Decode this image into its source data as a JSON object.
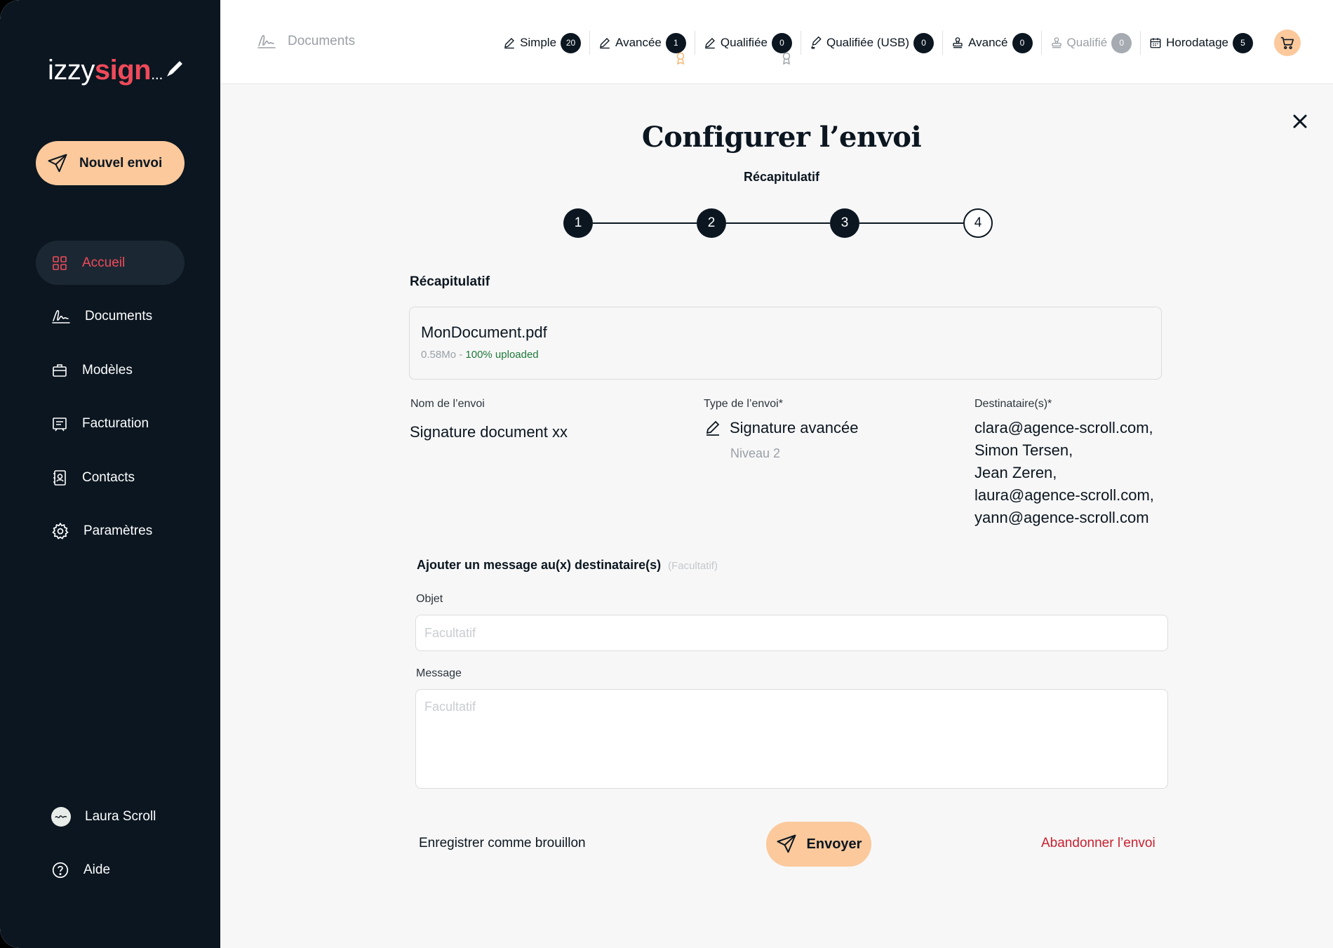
{
  "brand": {
    "part1": "izzy",
    "part2": "sign",
    "part3": "..."
  },
  "sidebar": {
    "new_button": "Nouvel envoi",
    "items": [
      {
        "label": "Accueil",
        "icon": "grid-icon",
        "active": true
      },
      {
        "label": "Documents",
        "icon": "signature-icon"
      },
      {
        "label": "Modèles",
        "icon": "briefcase-icon"
      },
      {
        "label": "Facturation",
        "icon": "invoice-icon"
      },
      {
        "label": "Contacts",
        "icon": "contact-icon"
      },
      {
        "label": "Paramètres",
        "icon": "gear-icon"
      }
    ],
    "user": "Laura Scroll",
    "help": "Aide"
  },
  "topbar": {
    "breadcrumb": "Documents",
    "counters": [
      {
        "label": "Simple",
        "count": "20"
      },
      {
        "label": "Avancée",
        "count": "1"
      },
      {
        "label": "Qualifiée",
        "count": "0"
      },
      {
        "label": "Qualifiée (USB)",
        "count": "0"
      },
      {
        "label": "Avancé",
        "count": "0"
      },
      {
        "label": "Qualifié",
        "count": "0"
      },
      {
        "label": "Horodatage",
        "count": "5"
      }
    ]
  },
  "page": {
    "title": "Configurer l’envoi",
    "subtitle": "Récapitulatif",
    "steps": [
      "1",
      "2",
      "3",
      "4"
    ],
    "current_step": 3,
    "section_title": "Récapitulatif"
  },
  "file": {
    "name": "MonDocument.pdf",
    "size": "0.58Mo",
    "separator": " - ",
    "status": "100% uploaded"
  },
  "summary": {
    "name_label": "Nom de l’envoi",
    "name_value": "Signature document xx",
    "type_label": "Type de l’envoi*",
    "type_value": "Signature avancée",
    "type_level": "Niveau 2",
    "recipients_label": "Destinataire(s)*",
    "recipients": [
      "clara@agence-scroll.com,",
      "Simon Tersen,",
      "Jean Zeren,",
      "laura@agence-scroll.com,",
      "yann@agence-scroll.com"
    ]
  },
  "message": {
    "title": "Ajouter un message au(x) destinataire(s)",
    "optional": "(Facultatif)",
    "subject_label": "Objet",
    "subject_placeholder": "Facultatif",
    "body_label": "Message",
    "body_placeholder": "Facultatif"
  },
  "actions": {
    "draft": "Enregistrer comme brouillon",
    "send": "Envoyer",
    "abandon": "Abandonner l’envoi"
  },
  "colors": {
    "sidebar_bg": "#0b1620",
    "accent": "#fbc99c",
    "brand_red": "#f04a5a",
    "success": "#1e7a3a",
    "danger": "#c8202f"
  }
}
